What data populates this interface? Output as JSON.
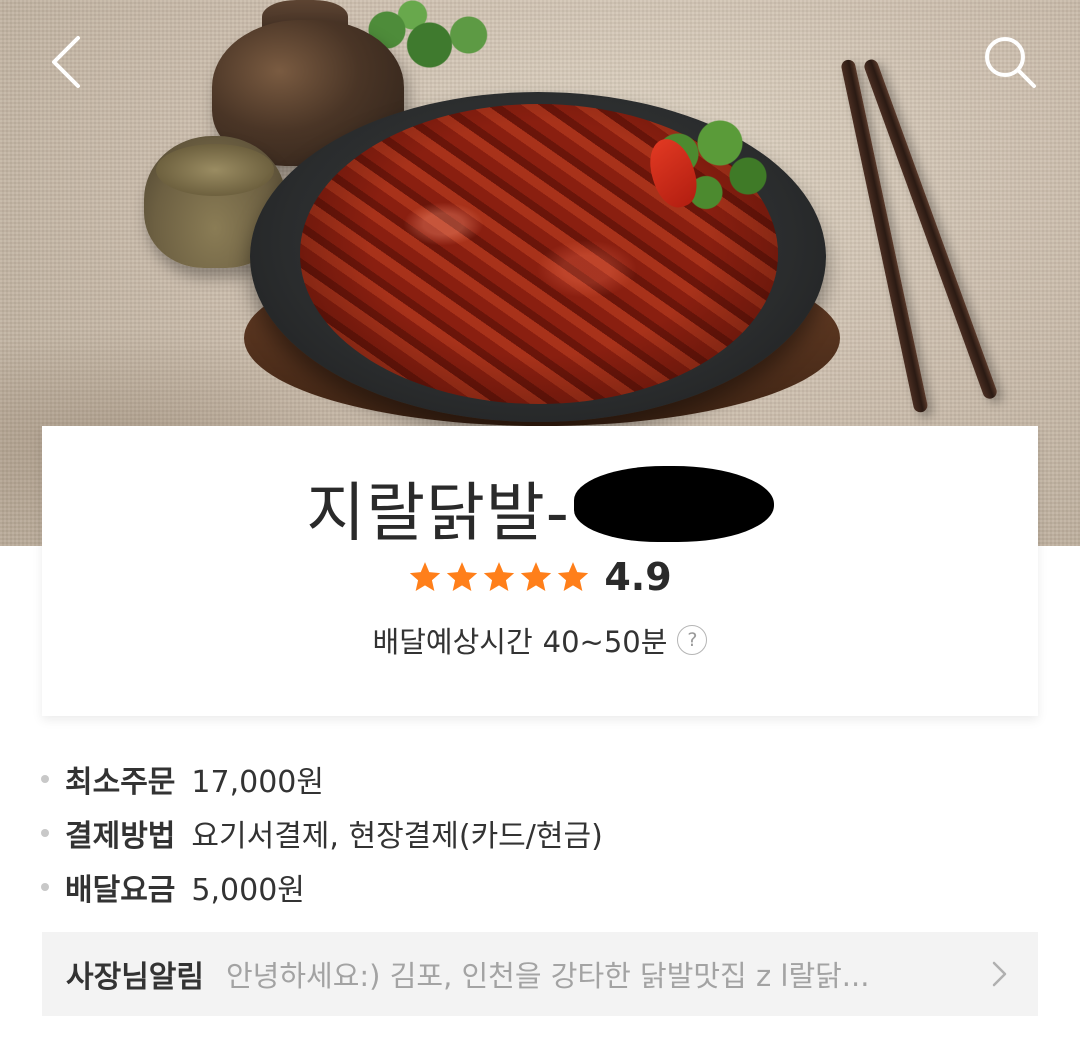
{
  "header": {
    "back_icon": "chevron-left-icon",
    "search_icon": "search-icon"
  },
  "store": {
    "name": "지랄닭발-",
    "rating": 4.9,
    "rating_text": "4.9",
    "rating_max": 5,
    "star_color": "#ff7f1a",
    "eta_label": "배달예상시간",
    "eta_value": "40~50분",
    "eta_help": "?"
  },
  "info": [
    {
      "key": "최소주문",
      "value": "17,000원"
    },
    {
      "key": "결제방법",
      "value": "요기서결제, 현장결제(카드/현금)"
    },
    {
      "key": "배달요금",
      "value": "5,000원"
    }
  ],
  "notice": {
    "label": "사장님알림",
    "text": "안녕하세요:) 김포, 인천을 강타한 닭발맛집 z l랄닭..."
  }
}
